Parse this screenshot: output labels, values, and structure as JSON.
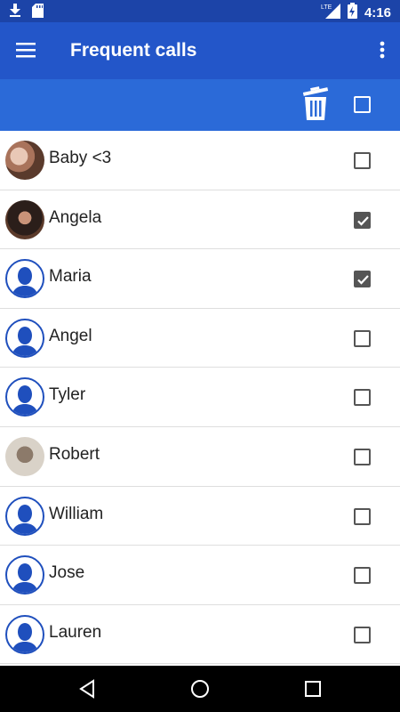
{
  "status_bar": {
    "time": "4:16",
    "network": "LTE",
    "icons": [
      "download-icon",
      "sd-card-icon",
      "signal-icon",
      "battery-charging-icon"
    ]
  },
  "app_bar": {
    "title": "Frequent calls",
    "menu_icon": "hamburger-menu-icon",
    "overflow_icon": "more-vert-icon"
  },
  "selection_bar": {
    "delete_icon": "trash-icon",
    "select_all_checked": false
  },
  "contacts": [
    {
      "name": "Baby <3",
      "avatar": "photo",
      "checked": false
    },
    {
      "name": "Angela",
      "avatar": "photo",
      "checked": true
    },
    {
      "name": "Maria",
      "avatar": "default",
      "checked": true
    },
    {
      "name": "Angel",
      "avatar": "default",
      "checked": false
    },
    {
      "name": "Tyler",
      "avatar": "default",
      "checked": false
    },
    {
      "name": "Robert",
      "avatar": "photo",
      "checked": false
    },
    {
      "name": "William",
      "avatar": "default",
      "checked": false
    },
    {
      "name": "Jose",
      "avatar": "default",
      "checked": false
    },
    {
      "name": "Lauren",
      "avatar": "default",
      "checked": false
    }
  ],
  "colors": {
    "status_bar": "#1c44a8",
    "app_bar": "#2356c9",
    "selection_bar": "#2b6ad8",
    "avatar_blue": "#1f4fbd"
  }
}
